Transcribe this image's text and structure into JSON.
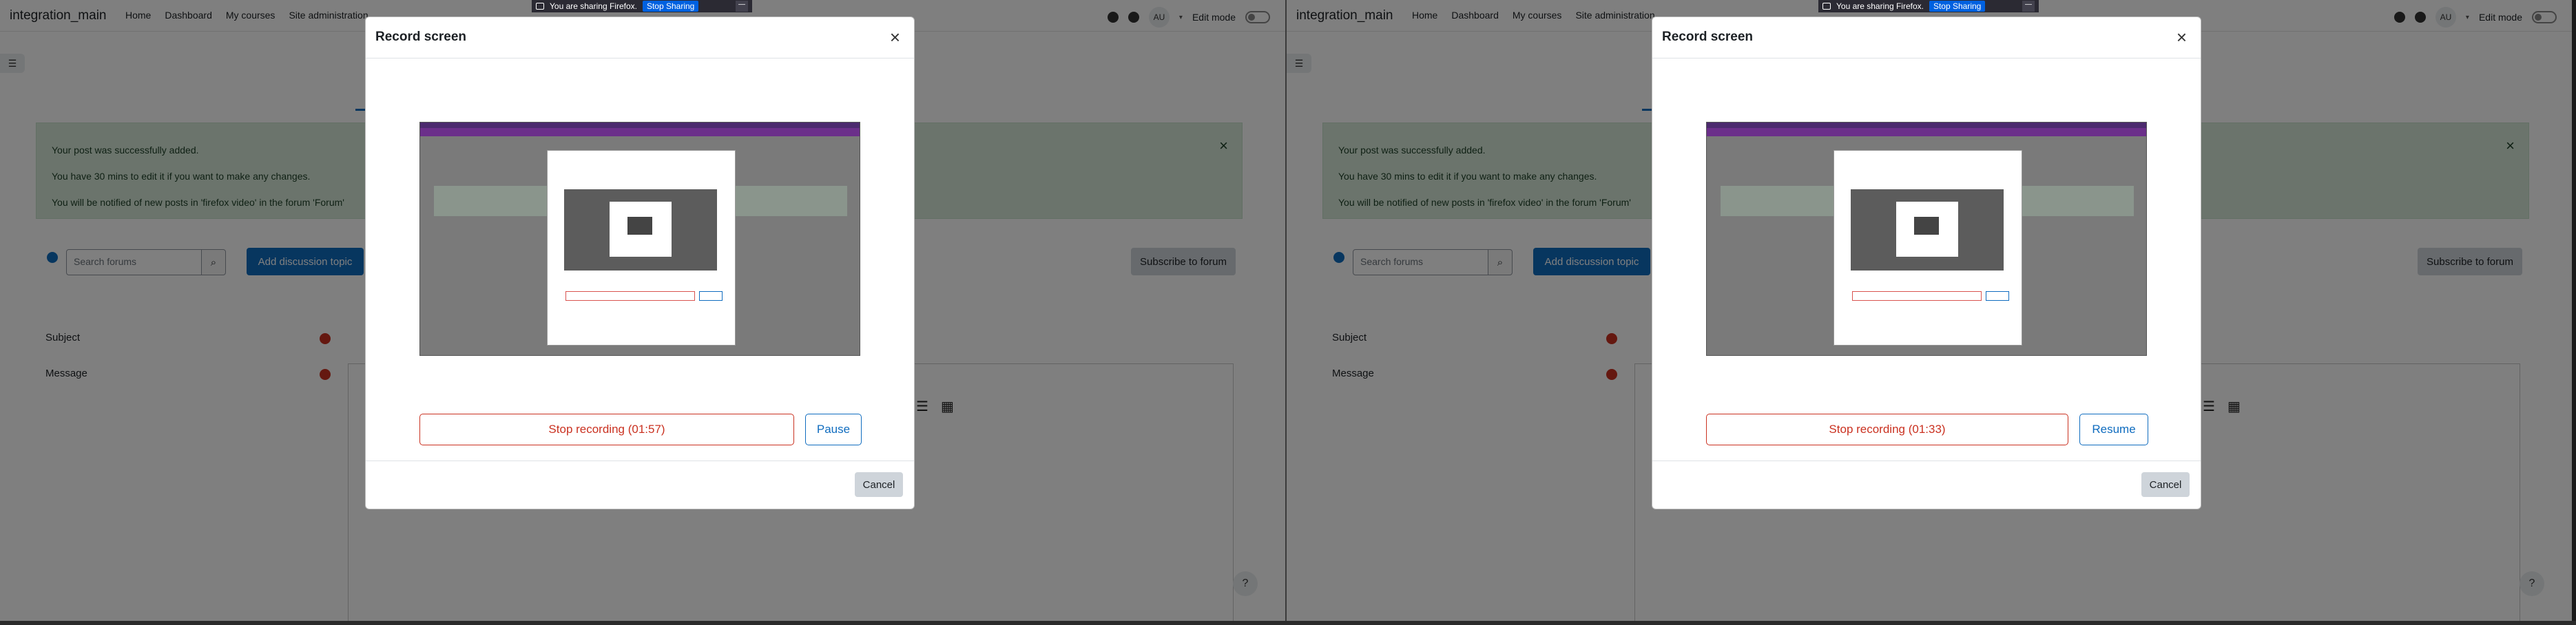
{
  "navbar": {
    "brand": "integration_main",
    "links": [
      "Home",
      "Dashboard",
      "My courses",
      "Site administration"
    ],
    "avatar": "AU",
    "edit_mode": "Edit mode"
  },
  "sharebar": {
    "text": "You are sharing Firefox.",
    "stop_label": "Stop Sharing"
  },
  "alert": {
    "lines": [
      "Your post was successfully added.",
      "You have 30 mins to edit it if you want to make any changes.",
      "You will be notified of new posts in 'firefox video' in the forum 'Forum'"
    ],
    "close": "×"
  },
  "forum": {
    "search_placeholder": "Search forums",
    "add_topic": "Add discussion topic",
    "subscribe": "Subscribe to forum"
  },
  "form": {
    "subject_label": "Subject",
    "message_label": "Message"
  },
  "modal": {
    "title": "Record screen",
    "close": "×",
    "cancel": "Cancel"
  },
  "left": {
    "stop_label": "Stop recording (01:57)",
    "toggle_label": "Pause"
  },
  "right": {
    "stop_label": "Stop recording (01:33)",
    "toggle_label": "Resume"
  },
  "colors": {
    "primary": "#0f6cbf",
    "danger": "#ca3120",
    "success_bg": "#d7e9d9"
  }
}
